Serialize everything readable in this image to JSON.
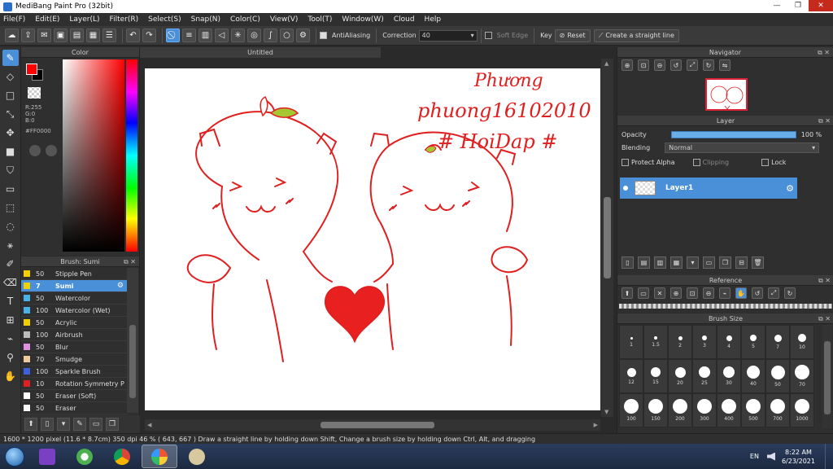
{
  "window": {
    "title": "MediBang Paint Pro (32bit)",
    "min": "—",
    "max": "❐",
    "close": "✕"
  },
  "menu": [
    "File(F)",
    "Edit(E)",
    "Layer(L)",
    "Filter(R)",
    "Select(S)",
    "Snap(N)",
    "Color(C)",
    "View(V)",
    "Tool(T)",
    "Window(W)",
    "Cloud",
    "Help"
  ],
  "toolbar": {
    "antialiasing_label": "AntiAliasing",
    "correction_label": "Correction",
    "correction_value": "40",
    "soft_edge_label": "Soft Edge",
    "key_label": "Key",
    "reset_label": "Reset",
    "straight_line_label": "Create a straight line"
  },
  "color_panel": {
    "title": "Color",
    "r": "R:255",
    "g": "G:0",
    "b": "B:0",
    "hex": "#FF0000",
    "foreground": "#ff0000",
    "background": "#000000"
  },
  "brush_panel": {
    "title": "Brush: Sumi",
    "items": [
      {
        "size": "50",
        "name": "Stipple Pen",
        "color": "#f0d000"
      },
      {
        "size": "7",
        "name": "Sumi",
        "color": "#f0d000",
        "selected": true
      },
      {
        "size": "50",
        "name": "Watercolor",
        "color": "#4ab0e8"
      },
      {
        "size": "100",
        "name": "Watercolor (Wet)",
        "color": "#4ab0e8"
      },
      {
        "size": "50",
        "name": "Acrylic",
        "color": "#f0d000"
      },
      {
        "size": "100",
        "name": "Airbrush",
        "color": "#bbbbbb"
      },
      {
        "size": "50",
        "name": "Blur",
        "color": "#e090e0"
      },
      {
        "size": "70",
        "name": "Smudge",
        "color": "#f0c8a0"
      },
      {
        "size": "100",
        "name": "Sparkle Brush",
        "color": "#4060e0"
      },
      {
        "size": "10",
        "name": "Rotation Symmetry P",
        "color": "#e02020"
      },
      {
        "size": "50",
        "name": "Eraser (Soft)",
        "color": "#ffffff"
      },
      {
        "size": "50",
        "name": "Eraser",
        "color": "#ffffff"
      }
    ]
  },
  "document": {
    "tab": "Untitled",
    "handwriting": {
      "line1": "Phương",
      "line2": "phuong16102010",
      "line3": "# HoiDap #"
    }
  },
  "navigator": {
    "title": "Navigator"
  },
  "layer_panel": {
    "title": "Layer",
    "opacity_label": "Opacity",
    "opacity_value": "100 %",
    "opacity": 1.0,
    "blending_label": "Blending",
    "blending_value": "Normal",
    "protect_alpha": "Protect Alpha",
    "clipping": "Clipping",
    "lock": "Lock",
    "layer_name": "Layer1"
  },
  "reference": {
    "title": "Reference"
  },
  "brush_size": {
    "title": "Brush Size",
    "sizes": [
      "1",
      "1.5",
      "2",
      "3",
      "4",
      "5",
      "7",
      "10",
      "12",
      "15",
      "20",
      "25",
      "30",
      "40",
      "50",
      "70",
      "100",
      "150",
      "200",
      "300",
      "400",
      "500",
      "700",
      "1000"
    ]
  },
  "status": {
    "text": "1600 * 1200 pixel  (11.6 * 8.7cm)  350 dpi  46 %  ( 643, 667 )  Draw a straight line by holding down Shift, Change a brush size by holding down Ctrl, Alt, and dragging"
  },
  "taskbar": {
    "lang": "EN",
    "time": "8:22 AM",
    "date": "6/23/2021"
  }
}
